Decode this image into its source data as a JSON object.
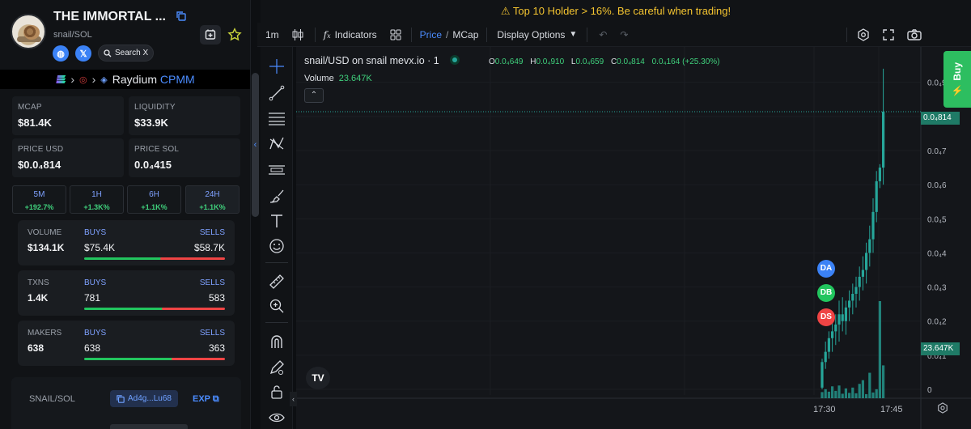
{
  "token": {
    "name": "THE IMMORTAL ...",
    "pair": "snail/SOL",
    "search_label": "Search X"
  },
  "route": {
    "dex": "Raydium",
    "pool_type": "CPMM"
  },
  "stats": [
    {
      "label": "MCAP",
      "value": "$81.4K"
    },
    {
      "label": "LIQUIDITY",
      "value": "$33.9K"
    },
    {
      "label": "PRICE USD",
      "value": "$0.0₄814"
    },
    {
      "label": "PRICE SOL",
      "value": "0.0₄415"
    }
  ],
  "timeframes": [
    {
      "label": "5M",
      "change": "+192.7%"
    },
    {
      "label": "1H",
      "change": "+1.3K%"
    },
    {
      "label": "6H",
      "change": "+1.1K%"
    },
    {
      "label": "24H",
      "change": "+1.1K%"
    }
  ],
  "metrics": [
    {
      "label": "VOLUME",
      "value": "$134.1K",
      "buys_label": "BUYS",
      "buys": "$75.4K",
      "sells_label": "SELLS",
      "sells": "$58.7K",
      "buy_ratio": 0.56
    },
    {
      "label": "TXNS",
      "value": "1.4K",
      "buys_label": "BUYS",
      "buys": "781",
      "sells_label": "SELLS",
      "sells": "583",
      "buy_ratio": 0.57
    },
    {
      "label": "MAKERS",
      "value": "638",
      "buys_label": "BUYS",
      "buys": "638",
      "sells_label": "SELLS",
      "sells": "363",
      "buy_ratio": 0.64
    }
  ],
  "pair_info": {
    "label": "SNAIL/SOL",
    "address": "Ad4g...Lu68",
    "explorer": "EXP"
  },
  "warning": "Top 10 Holder > 16%. Be careful when trading!",
  "toolbar": {
    "interval": "1m",
    "indicators": "Indicators",
    "price": "Price",
    "mcap": "MCap",
    "display_options": "Display Options"
  },
  "chart_legend": {
    "title": "snail/USD on snail mevx.io · 1",
    "open_label": "O",
    "open": "0.0₄649",
    "high_label": "H",
    "high": "0.0₄910",
    "low_label": "L",
    "low": "0.0₄659",
    "close_label": "C",
    "close": "0.0₄814",
    "change": "0.0₄164 (+25.30%)",
    "volume_label": "Volume",
    "volume": "23.647K"
  },
  "buy_label": "Buy",
  "price_tag": "0.0₄814",
  "volume_tag": "23.647K",
  "markers": [
    "DA",
    "DB",
    "DS"
  ],
  "colors": {
    "up": "#26a69a",
    "buy_green": "#2dbe60",
    "warning": "#f4c430",
    "accent": "#4b8cff"
  },
  "chart_data": {
    "type": "candlestick",
    "x_labels": [
      "17:30",
      "17:45"
    ],
    "y_tick_labels": [
      "0.0₄9",
      "0.0₄8",
      "0.0₄7",
      "0.0₄6",
      "0.0₄5",
      "0.0₄4",
      "0.0₄3",
      "0.0₄2",
      "0.0₄1",
      "0"
    ],
    "y_ticks": [
      9e-06,
      8e-06,
      7e-06,
      6e-06,
      5e-06,
      4e-06,
      3e-06,
      2e-06,
      1e-06,
      0
    ],
    "ylim": [
      0,
      9.8e-06
    ],
    "close_line": 8.14e-06,
    "candles": [
      {
        "o": 5e-08,
        "h": 9e-07,
        "l": 0.0,
        "c": 8e-07
      },
      {
        "o": 8e-07,
        "h": 1.4e-06,
        "l": 6e-07,
        "c": 1.1e-06
      },
      {
        "o": 1.1e-06,
        "h": 1.7e-06,
        "l": 9e-07,
        "c": 1.5e-06
      },
      {
        "o": 1.5e-06,
        "h": 2e-06,
        "l": 1.1e-06,
        "c": 1.7e-06
      },
      {
        "o": 1.7e-06,
        "h": 2.2e-06,
        "l": 1.3e-06,
        "c": 1.9e-06
      },
      {
        "o": 1.9e-06,
        "h": 2.6e-06,
        "l": 1.4e-06,
        "c": 2.2e-06
      },
      {
        "o": 2.2e-06,
        "h": 2.7e-06,
        "l": 1.7e-06,
        "c": 2e-06
      },
      {
        "o": 2e-06,
        "h": 2.6e-06,
        "l": 1.6e-06,
        "c": 2.4e-06
      },
      {
        "o": 2.4e-06,
        "h": 2.9e-06,
        "l": 2e-06,
        "c": 2.6e-06
      },
      {
        "o": 2.6e-06,
        "h": 3.1e-06,
        "l": 2.2e-06,
        "c": 2.8e-06
      },
      {
        "o": 2.8e-06,
        "h": 3.3e-06,
        "l": 2.4e-06,
        "c": 3e-06
      },
      {
        "o": 3e-06,
        "h": 3.6e-06,
        "l": 2.6e-06,
        "c": 3.3e-06
      },
      {
        "o": 3.3e-06,
        "h": 3.9e-06,
        "l": 2.9e-06,
        "c": 3.5e-06
      },
      {
        "o": 3.5e-06,
        "h": 4.3e-06,
        "l": 3.1e-06,
        "c": 4e-06
      },
      {
        "o": 4e-06,
        "h": 4.8e-06,
        "l": 3.6e-06,
        "c": 4.4e-06
      },
      {
        "o": 4.4e-06,
        "h": 5.6e-06,
        "l": 4e-06,
        "c": 5.2e-06
      },
      {
        "o": 5.2e-06,
        "h": 6.4e-06,
        "l": 4.9e-06,
        "c": 6.1e-06
      },
      {
        "o": 6.1e-06,
        "h": 6.6e-06,
        "l": 5.9e-06,
        "c": 6.5e-06
      },
      {
        "o": 6.5e-06,
        "h": 9.4e-06,
        "l": 6e-06,
        "c": 8.14e-06
      }
    ],
    "volume": [
      1.5,
      2.2,
      1.6,
      2.9,
      1.8,
      3.1,
      1.1,
      2.4,
      1.3,
      2.6,
      1.2,
      3.5,
      4.4,
      1.0,
      6.2,
      1.4,
      2.2,
      23.647,
      8.0
    ]
  }
}
